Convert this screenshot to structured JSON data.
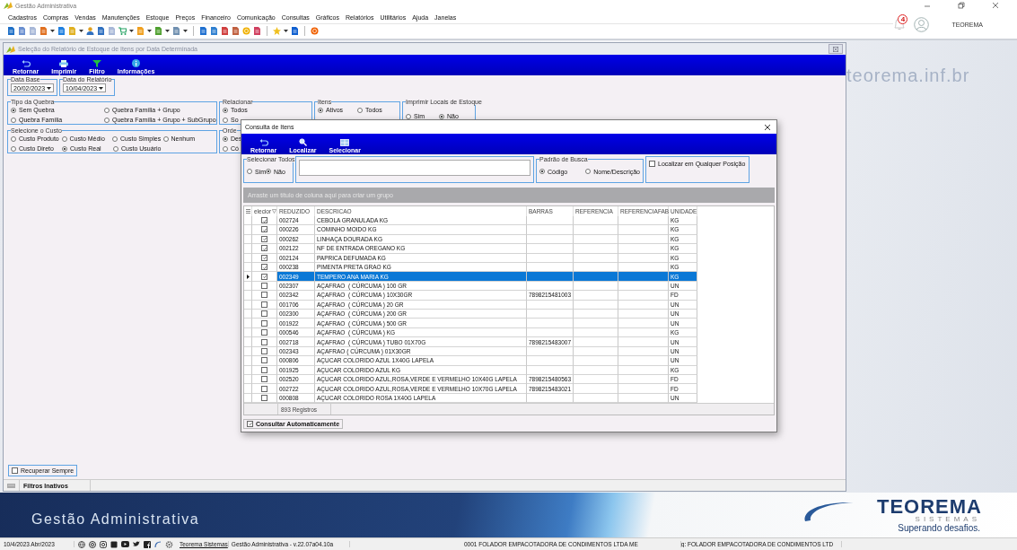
{
  "window": {
    "title": "Gestão Administrativa"
  },
  "menu": [
    "Cadastros",
    "Compras",
    "Vendas",
    "Manutenções",
    "Estoque",
    "Preços",
    "Financeiro",
    "Comunicação",
    "Consultas",
    "Gráficos",
    "Relatórios",
    "Utilitários",
    "Ajuda",
    "Janelas"
  ],
  "header": {
    "notification_count": "4",
    "user": "TEOREMA"
  },
  "desktop": {
    "website": "teorema.inf.br"
  },
  "report_window": {
    "title": "Seleção do Relatório de Estoque de Itens por Data Determinada",
    "toolbar": [
      {
        "label": "Retornar",
        "kind": "return"
      },
      {
        "label": "Imprimir",
        "kind": "print"
      },
      {
        "label": "Filtro",
        "kind": "filter"
      },
      {
        "label": "Informações",
        "kind": "info"
      }
    ],
    "date_fields": [
      {
        "label": "Data Base",
        "value": "20/02/2023"
      },
      {
        "label": "Data do Relatório",
        "value": "10/04/2023"
      }
    ],
    "option_groups": [
      {
        "title": "Tipo da Quebra",
        "kind": "wide",
        "rows": [
          [
            {
              "label": "Sem Quebra",
              "selected": true
            },
            {
              "label": "Quebra Família + Grupo",
              "selected": false
            }
          ],
          [
            {
              "label": "Quebra Família",
              "selected": false
            },
            {
              "label": "Quebra Família + Grupo + SubGrupo",
              "selected": false
            }
          ]
        ]
      },
      {
        "title": "Relacionar",
        "kind": "stack",
        "rows": [
          [
            {
              "label": "Todos",
              "selected": true
            }
          ],
          [
            {
              "label": "So",
              "selected": false
            }
          ]
        ]
      },
      {
        "title": "Itens",
        "kind": "pair",
        "rows": [
          [
            {
              "label": "Ativos",
              "selected": true
            },
            {
              "label": "Todos",
              "selected": false
            }
          ]
        ]
      },
      {
        "title": "Imprimir Locais de Estoque",
        "kind": "low",
        "rows": [
          [
            {
              "label": "Sim",
              "selected": false
            },
            {
              "label": "Não",
              "selected": true
            }
          ]
        ]
      },
      {
        "title": "Selecione o Custo",
        "kind": "wide4",
        "rows": [
          [
            {
              "label": "Custo Produto",
              "selected": false
            },
            {
              "label": "Custo Médio",
              "selected": false
            },
            {
              "label": "Custo Simples",
              "selected": false
            },
            {
              "label": "Nenhum",
              "selected": false
            }
          ],
          [
            {
              "label": "Custo Direto",
              "selected": false
            },
            {
              "label": "Custo Real",
              "selected": true
            },
            {
              "label": "Custo Usuário",
              "selected": false
            }
          ]
        ]
      },
      {
        "title": "Orde",
        "kind": "stack",
        "rows": [
          [
            {
              "label": "Des",
              "selected": true
            }
          ],
          [
            {
              "label": "Có",
              "selected": false
            }
          ]
        ]
      }
    ],
    "recover_always": {
      "label": "Recuperar Sempre",
      "checked": false
    },
    "status": "Filtros Inativos"
  },
  "dialog": {
    "title": "Consulta de Itens",
    "toolbar": [
      {
        "label": "Retornar",
        "kind": "return"
      },
      {
        "label": "Localizar",
        "kind": "search"
      },
      {
        "label": "Selecionar",
        "kind": "grid"
      }
    ],
    "select_all": {
      "title": "Selecionar Todos",
      "options": [
        {
          "label": "Sim",
          "selected": false
        },
        {
          "label": "Não",
          "selected": true
        }
      ]
    },
    "search_mode": {
      "title": "Padrão de Busca",
      "options": [
        {
          "label": "Código",
          "selected": true
        },
        {
          "label": "Nome/Descrição",
          "selected": false
        }
      ]
    },
    "anywhere": {
      "label": "Localizar em Qualquer Posição",
      "checked": false
    },
    "group_hint": "Arraste um título de coluna aqui para criar um grupo",
    "grid": {
      "columns": [
        "elecior",
        "REDUZIDO",
        "DESCRICAO",
        "BARRAS",
        "REFERENCIA",
        "REFERENCIAFAB",
        "UNIDADE"
      ],
      "rows": [
        {
          "checked": true,
          "selected": false,
          "reduzido": "002724",
          "descricao": "CEBOLA GRANULADA KG",
          "unidade": "KG"
        },
        {
          "checked": true,
          "selected": false,
          "reduzido": "000226",
          "descricao": "COMINHO MOIDO KG",
          "unidade": "KG"
        },
        {
          "checked": true,
          "selected": false,
          "reduzido": "000262",
          "descricao": "LINHAÇA DOURADA KG",
          "unidade": "KG"
        },
        {
          "checked": true,
          "selected": false,
          "reduzido": "002122",
          "descricao": "NF DE ENTRADA OREGANO KG",
          "unidade": "KG"
        },
        {
          "checked": true,
          "selected": false,
          "reduzido": "002124",
          "descricao": "PAPRICA DEFUMADA KG",
          "unidade": "KG"
        },
        {
          "checked": true,
          "selected": false,
          "reduzido": "000238",
          "descricao": "PIMENTA PRETA GRAO KG",
          "unidade": "KG"
        },
        {
          "checked": true,
          "selected": true,
          "reduzido": "002349",
          "descricao": "TEMPERO ANA MARIA KG",
          "unidade": "KG"
        },
        {
          "checked": false,
          "selected": false,
          "reduzido": "002307",
          "descricao": "AÇAFRAO  ( CÚRCUMA ) 100 GR",
          "unidade": "UN"
        },
        {
          "checked": false,
          "selected": false,
          "reduzido": "002342",
          "descricao": "AÇAFRAO  ( CÚRCUMA ) 10X30GR",
          "barras": "7898215481003",
          "unidade": "FD"
        },
        {
          "checked": false,
          "selected": false,
          "reduzido": "001706",
          "descricao": "AÇAFRAO  ( CÚRCUMA ) 20 GR",
          "unidade": "UN"
        },
        {
          "checked": false,
          "selected": false,
          "reduzido": "002300",
          "descricao": "AÇAFRAO  ( CÚRCUMA ) 200 GR",
          "unidade": "UN"
        },
        {
          "checked": false,
          "selected": false,
          "reduzido": "001922",
          "descricao": "AÇAFRAO  ( CÚRCUMA ) 500 GR",
          "unidade": "UN"
        },
        {
          "checked": false,
          "selected": false,
          "reduzido": "000546",
          "descricao": "AÇAFRAO  ( CÚRCUMA ) KG",
          "unidade": "KG"
        },
        {
          "checked": false,
          "selected": false,
          "reduzido": "002718",
          "descricao": "AÇAFRAO  ( CÚRCUMA ) TUBO 01X70G",
          "barras": "7898215483007",
          "unidade": "UN"
        },
        {
          "checked": false,
          "selected": false,
          "reduzido": "002343",
          "descricao": "AÇAFRAO ( CÚRCUMA ) 01X30GR",
          "unidade": "UN"
        },
        {
          "checked": false,
          "selected": false,
          "reduzido": "000806",
          "descricao": "AÇUCAR COLORIDO AZUL 1X40G LAPELA",
          "unidade": "UN"
        },
        {
          "checked": false,
          "selected": false,
          "reduzido": "001925",
          "descricao": "AÇUCAR COLORIDO AZUL KG",
          "unidade": "KG"
        },
        {
          "checked": false,
          "selected": false,
          "reduzido": "002520",
          "descricao": "AÇUCAR COLORIDO AZUL,ROSA,VERDE E VERMELHO 10X40G LAPELA",
          "barras": "7898215480563",
          "unidade": "FD"
        },
        {
          "checked": false,
          "selected": false,
          "reduzido": "002722",
          "descricao": "AÇUCAR COLORIDO AZUL,ROSA,VERDE E VERMELHO 10X70G LAPELA",
          "barras": "7898215483021",
          "unidade": "FD"
        },
        {
          "checked": false,
          "selected": false,
          "reduzido": "000808",
          "descricao": "AÇUCAR COLORIDO ROSA 1X40G LAPELA",
          "unidade": "UN"
        }
      ],
      "footer": "893 Registros"
    },
    "auto_query": {
      "label": "Consultar Automaticamente",
      "checked": true
    }
  },
  "banner": {
    "title": "Gestão Administrativa",
    "logo": "TEOREMA",
    "logo_subtitle": "SISTEMAS",
    "slogan": "Superando desafios."
  },
  "status_bar": {
    "date": "10/4/2023 Abr/2023",
    "link": "Teorema Sistemas",
    "version": "Gestão Administrativa - v.22.07a04.10a",
    "company": "0001 FOLADOR EMPACOTADORA DE CONDIMENTOS LTDA ME",
    "company_2": "g: FOLADOR EMPACOTADORA DE CONDIMENTOS LTD"
  }
}
